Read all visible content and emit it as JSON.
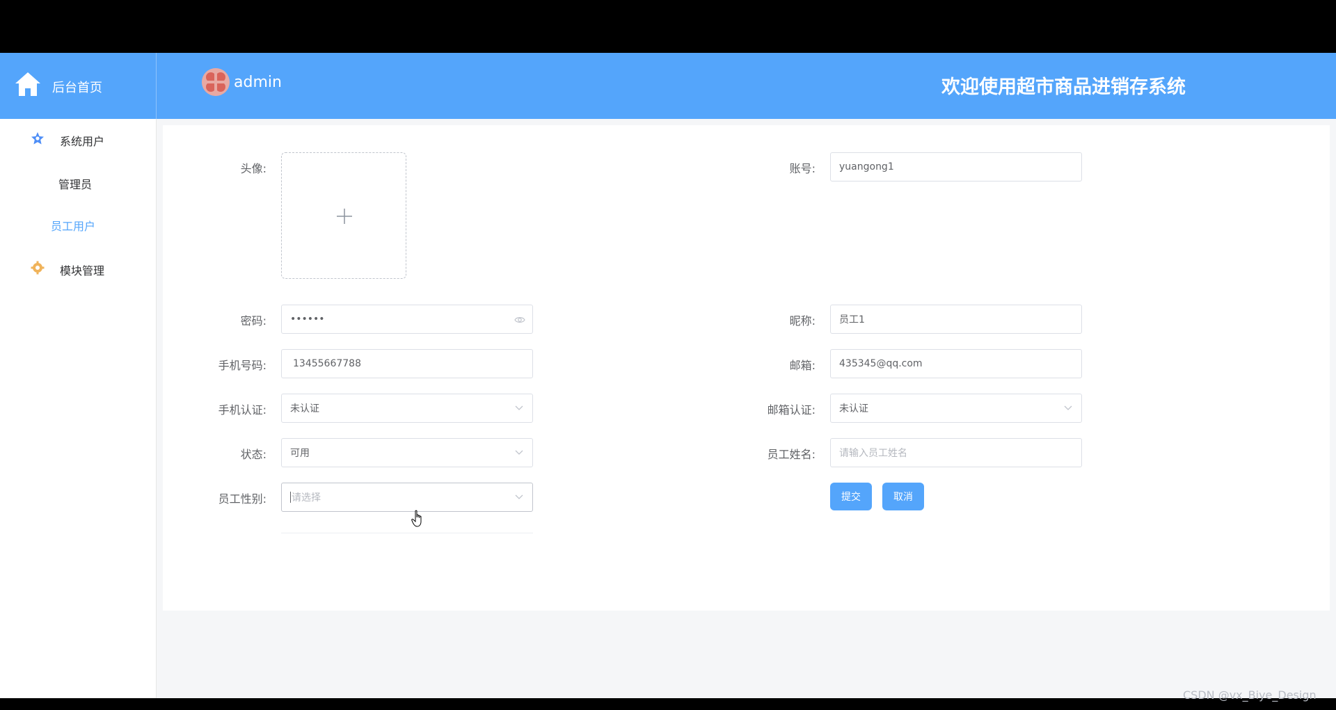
{
  "header": {
    "home_label": "后台首页",
    "admin_name": "admin",
    "welcome_text": "欢迎使用超市商品进销存系统",
    "bg_color": "#54a5fb"
  },
  "sidebar": {
    "groups": [
      {
        "label": "系统用户",
        "icon": "star-icon",
        "items": [
          {
            "label": "管理员",
            "active": false
          },
          {
            "label": "员工用户",
            "active": true
          }
        ]
      },
      {
        "label": "模块管理",
        "icon": "gear-icon",
        "items": []
      }
    ]
  },
  "form": {
    "avatar_label": "头像:",
    "account_label": "账号:",
    "account_value": "yuangong1",
    "password_label": "密码:",
    "password_value": "••••••",
    "nickname_label": "昵称:",
    "nickname_value": "员工1",
    "phone_label": "手机号码:",
    "phone_value": "13455667788",
    "email_label": "邮箱:",
    "email_value": "435345@qq.com",
    "phone_verify_label": "手机认证:",
    "phone_verify_value": "未认证",
    "email_verify_label": "邮箱认证:",
    "email_verify_value": "未认证",
    "status_label": "状态:",
    "status_value": "可用",
    "employee_name_label": "员工姓名:",
    "employee_name_placeholder": "请输入员工姓名",
    "gender_label": "员工性别:",
    "gender_placeholder": "请选择",
    "submit_label": "提交",
    "cancel_label": "取消"
  },
  "watermark": "CSDN @vx_Biye_Design"
}
